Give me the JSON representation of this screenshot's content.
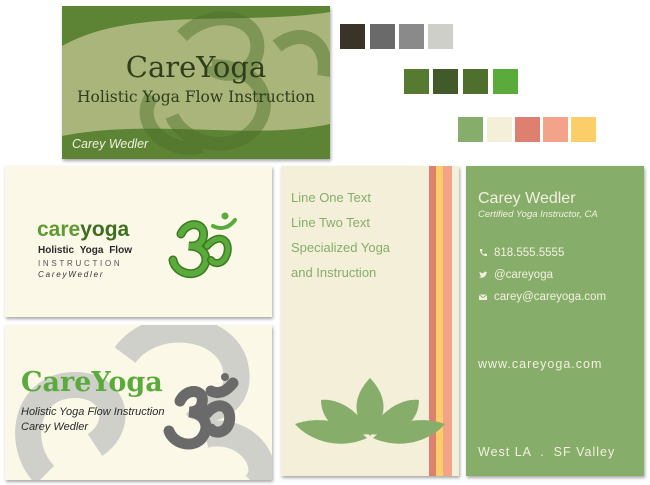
{
  "palette": {
    "row1": [
      "#3a3327",
      "#6a6a6a",
      "#8a8a8a",
      "#cfcfc9"
    ],
    "row2": [
      "#557a30",
      "#42592a",
      "#4f6f2d",
      "#5aaa3c"
    ],
    "row3": [
      "#86ad6a",
      "#f4efd9",
      "#de8070",
      "#f2a38a",
      "#fbce6a"
    ]
  },
  "card1": {
    "brand": "CareYoga",
    "tagline": "Holistic Yoga Flow Instruction",
    "name": "Carey Wedler"
  },
  "card2": {
    "brand_light": "care",
    "brand_bold": "yoga",
    "line1": "Holistic Yoga Flow",
    "line2": "INSTRUCTION",
    "name": "CareyWedler"
  },
  "card3": {
    "brand": "CareYoga",
    "tagline": "Holistic Yoga Flow Instruction",
    "name": "Carey Wedler"
  },
  "card4": {
    "lines": [
      "Line One Text",
      "Line Two Text",
      "Specialized Yoga",
      "and Instruction"
    ]
  },
  "card5": {
    "name": "Carey Wedler",
    "title": "Certified Yoga Instructor, CA",
    "phone": "818.555.5555",
    "twitter": "@careyoga",
    "email": "carey@careyoga.com",
    "website": "www.careyoga.com",
    "locations": "West LA  .  SF Valley"
  }
}
